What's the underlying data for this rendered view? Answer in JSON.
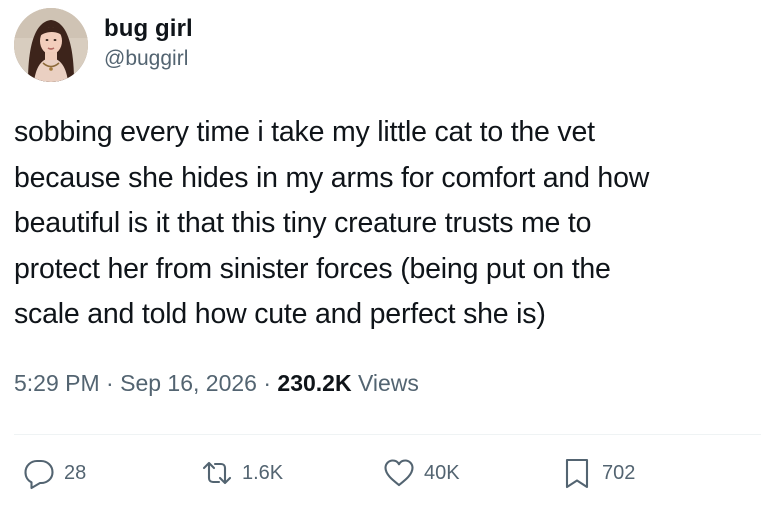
{
  "author": {
    "display_name": "bug girl",
    "handle": "@buggirl",
    "avatar_icon": "profile-photo"
  },
  "tweet": {
    "text": "sobbing every time i take my little cat to the vet\nbecause she hides in my arms for comfort and how\nbeautiful is it that this tiny creature trusts me to\nprotect her from sinister forces (being put on the\nscale and told how cute and perfect she is)"
  },
  "meta": {
    "time": "5:29 PM",
    "separator": " · ",
    "date": "Sep 16, 2026",
    "views_count": "230.2K",
    "views_label": "Views"
  },
  "actions": {
    "replies": "28",
    "retweets": "1.6K",
    "likes": "40K",
    "bookmarks": "702"
  },
  "colors": {
    "text_primary": "#0f1419",
    "text_secondary": "#536471",
    "divider": "#eff3f4"
  }
}
